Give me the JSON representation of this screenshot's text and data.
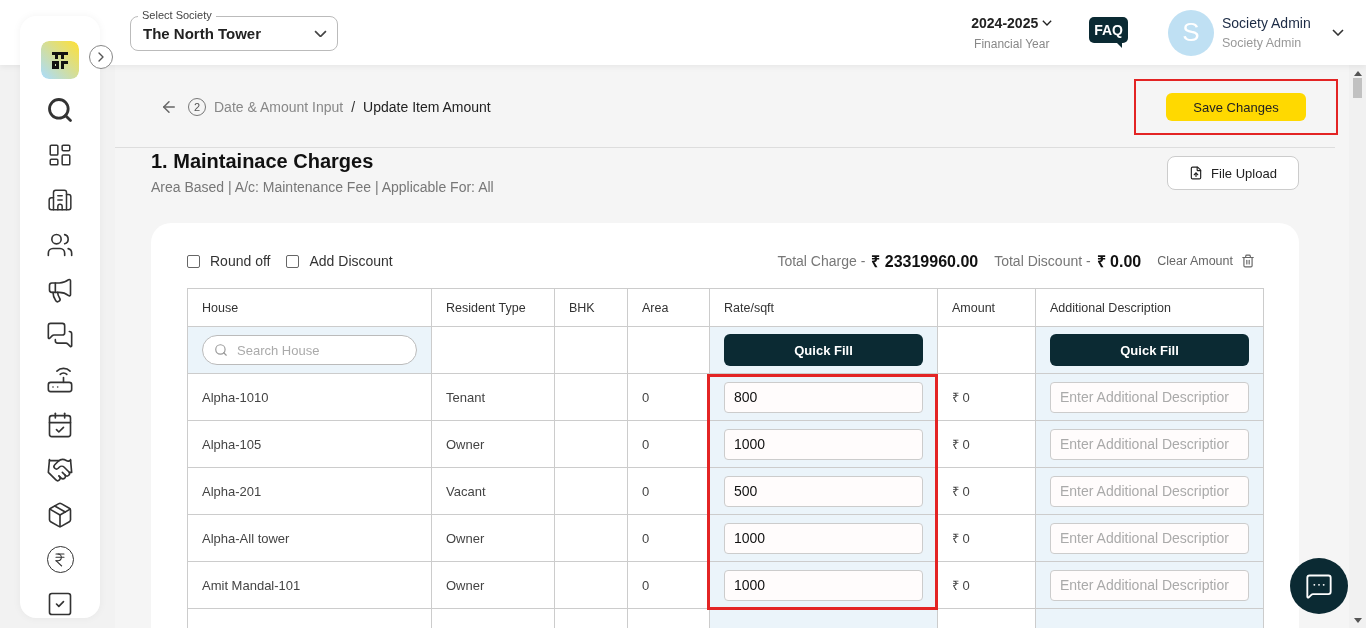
{
  "header": {
    "society_select": {
      "label": "Select Society",
      "value": "The North Tower"
    },
    "financial_year": {
      "value": "2024-2025",
      "label": "Financial Year"
    },
    "faq": "FAQ",
    "user": {
      "initial": "S",
      "name": "Society Admin",
      "role": "Society Admin"
    }
  },
  "breadcrumb": {
    "step": "2",
    "parent": "Date & Amount Input",
    "separator": "/",
    "current": "Update Item Amount"
  },
  "save_button": {
    "label": "Save Changes",
    "highlighted": true
  },
  "section": {
    "title": "1. Maintainace Charges",
    "subtitle": "Area Based | A/c: Maintenance Fee | Applicable For: All",
    "file_upload": "File Upload"
  },
  "options": [
    {
      "label": "Round off",
      "checked": false
    },
    {
      "label": "Add Discount",
      "checked": false
    }
  ],
  "totals": {
    "charge_label": "Total Charge -",
    "charge_value": "₹ 23319960.00",
    "discount_label": "Total Discount -",
    "discount_value": "₹ 0.00",
    "clear": "Clear Amount"
  },
  "table": {
    "columns": [
      {
        "label": "House",
        "highlighted": false
      },
      {
        "label": "Resident Type",
        "highlighted": false
      },
      {
        "label": "BHK",
        "highlighted": false
      },
      {
        "label": "Area",
        "highlighted": false
      },
      {
        "label": "Rate/sqft",
        "highlighted": true
      },
      {
        "label": "Amount",
        "highlighted": false
      },
      {
        "label": "Additional Description",
        "highlighted": false
      }
    ],
    "search_placeholder": "Search House",
    "quick_fill": [
      "Quick Fill",
      "Quick Fill"
    ],
    "rows": [
      {
        "house": "Alpha-1010",
        "resident_type": "Tenant",
        "area": "0",
        "rate": "800",
        "amount": "₹ 0",
        "description_placeholder": "Enter Additional Descriptior"
      },
      {
        "house": "Alpha-105",
        "resident_type": "Owner",
        "area": "0",
        "rate": "1000",
        "amount": "₹ 0",
        "description_placeholder": "Enter Additional Descriptior"
      },
      {
        "house": "Alpha-201",
        "resident_type": "Vacant",
        "area": "0",
        "rate": "500",
        "amount": "₹ 0",
        "description_placeholder": "Enter Additional Descriptior"
      },
      {
        "house": "Alpha-All tower",
        "resident_type": "Owner",
        "area": "0",
        "rate": "1000",
        "amount": "₹ 0",
        "description_placeholder": "Enter Additional Descriptior"
      },
      {
        "house": "Amit Mandal-101",
        "resident_type": "Owner",
        "area": "0",
        "rate": "1000",
        "amount": "₹ 0",
        "description_placeholder": "Enter Additional Descriptior"
      }
    ]
  }
}
